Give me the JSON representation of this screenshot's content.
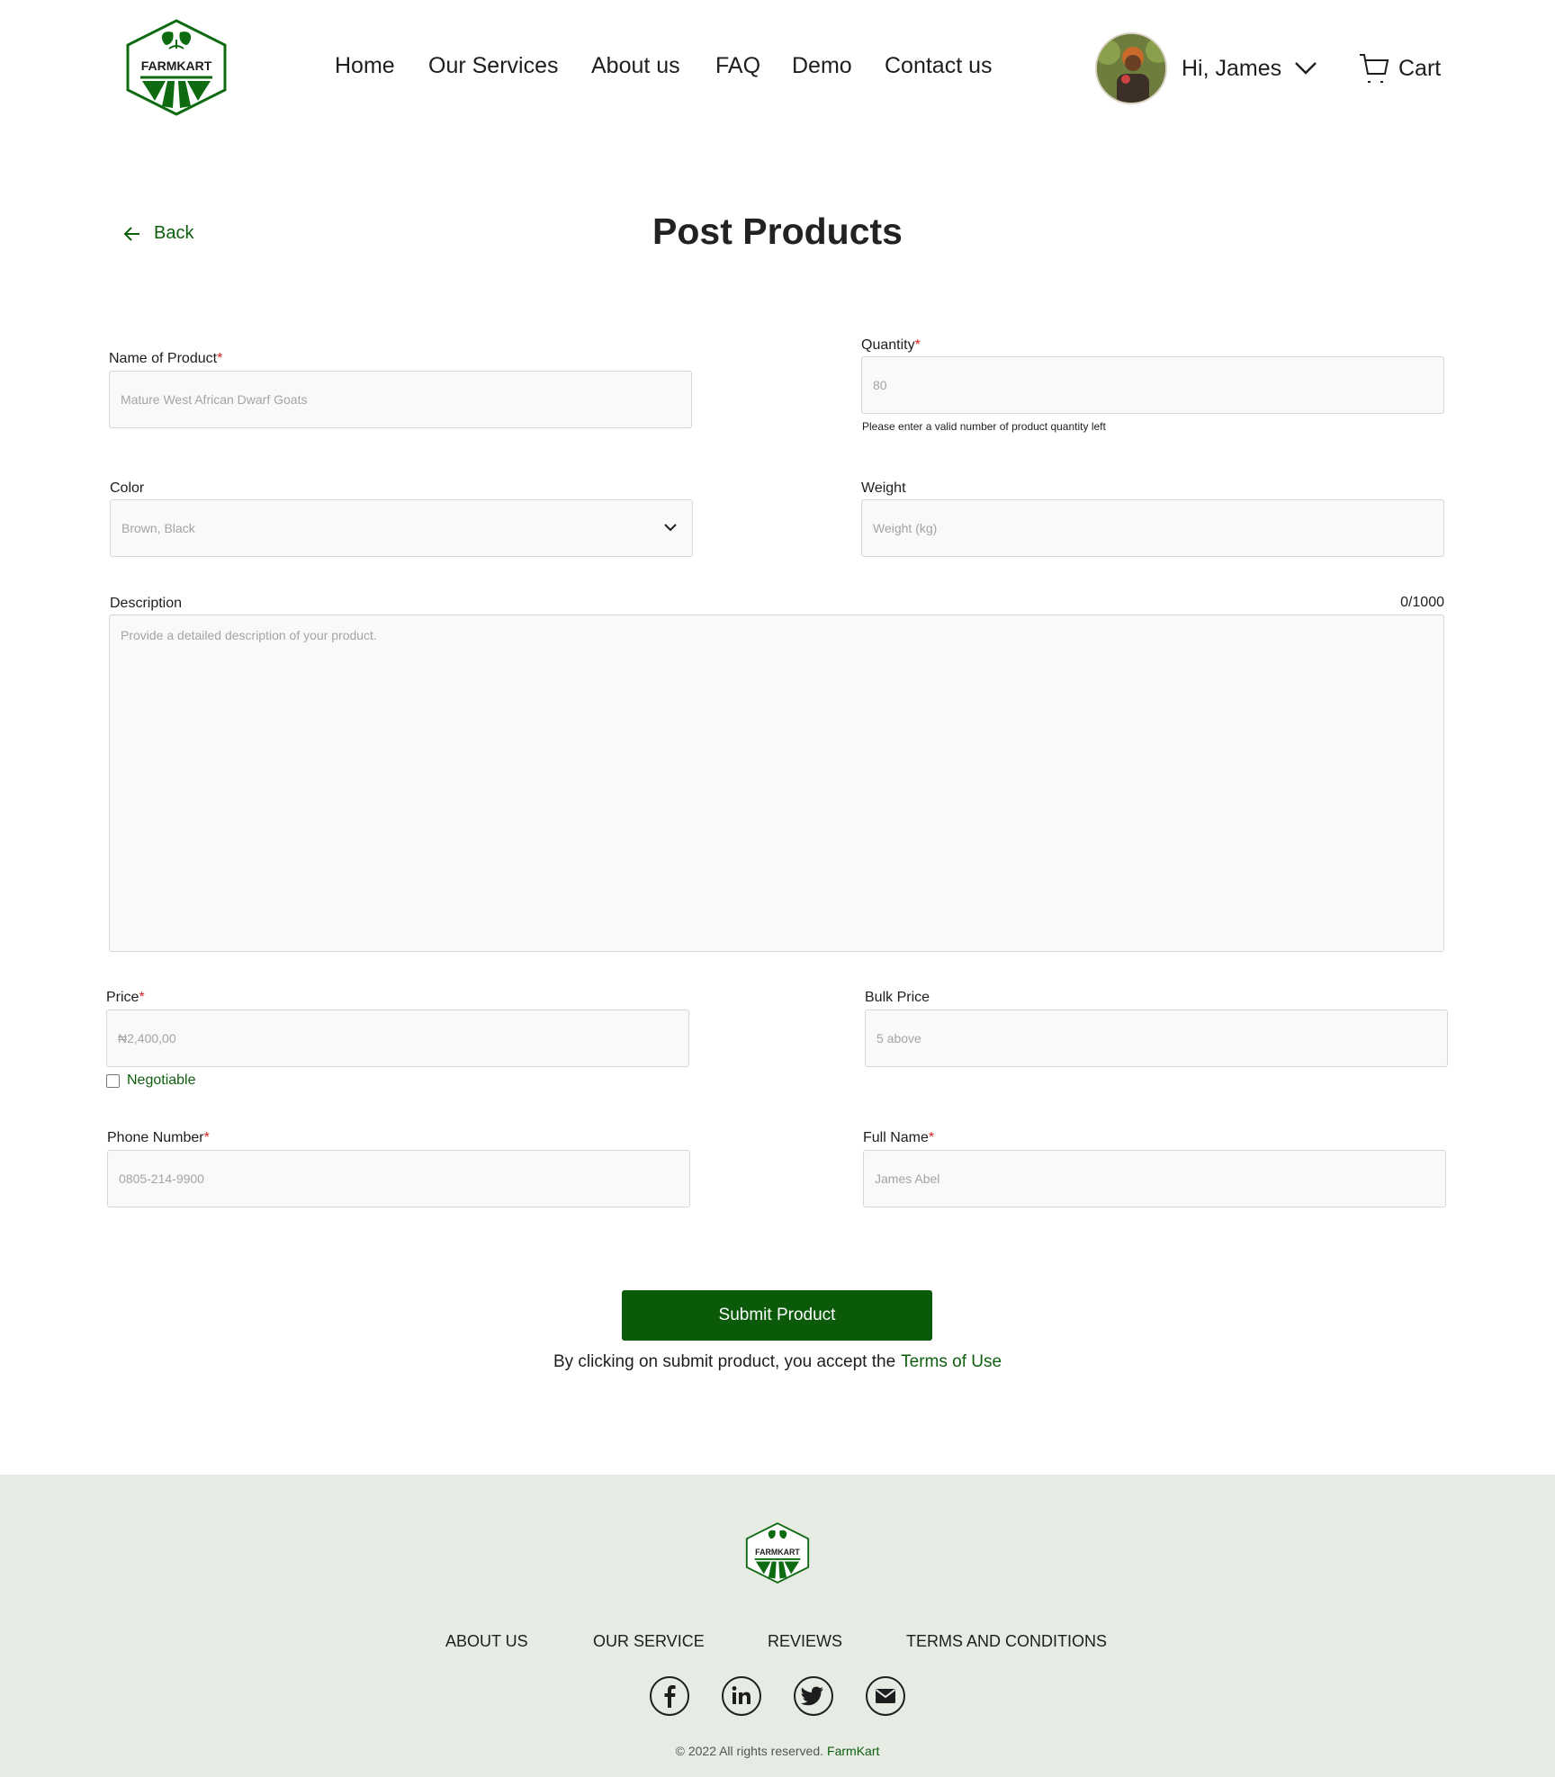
{
  "brand": {
    "logo_text": "FARMKART",
    "accent_color": "#0a5a0a",
    "link_color": "#0e5e0e"
  },
  "nav": {
    "items": [
      {
        "label": "Home"
      },
      {
        "label": "Our Services"
      },
      {
        "label": "About us"
      },
      {
        "label": "FAQ"
      },
      {
        "label": "Demo"
      },
      {
        "label": "Contact us"
      }
    ]
  },
  "user": {
    "greeting": "Hi, James",
    "avatar_icon": "user-avatar",
    "dropdown_icon": "chevron-down-icon"
  },
  "cart": {
    "label": "Cart",
    "icon": "cart-icon"
  },
  "page": {
    "back_label": "Back",
    "title": "Post Products"
  },
  "form": {
    "product_name": {
      "label": "Name of Product",
      "required_mark": "*",
      "placeholder": "Mature West African Dwarf Goats"
    },
    "quantity": {
      "label": "Quantity",
      "required_mark": "*",
      "placeholder": "80",
      "helper": "Please enter a  valid number of product quantity left"
    },
    "color": {
      "label": "Color",
      "selected": "Brown, Black"
    },
    "weight": {
      "label": "Weight",
      "placeholder": "Weight (kg)"
    },
    "description": {
      "label": "Description",
      "counter": "0/1000",
      "placeholder": "Provide a detailed description of your product."
    },
    "price": {
      "label": "Price",
      "required_mark": "*",
      "placeholder": "₦2,400,00"
    },
    "negotiable": {
      "label": "Negotiable",
      "checked": false
    },
    "bulk_price": {
      "label": "Bulk Price",
      "placeholder": "5 above"
    },
    "phone": {
      "label": "Phone Number",
      "required_mark": "*",
      "placeholder": "0805-214-9900"
    },
    "full_name": {
      "label": "Full Name",
      "required_mark": "*",
      "placeholder": "James Abel"
    },
    "submit_label": "Submit Product",
    "terms_text": "By clicking on submit product, you accept the",
    "terms_link": "Terms of Use"
  },
  "footer": {
    "logo_text": "FARMKART",
    "links": [
      {
        "label": "ABOUT US"
      },
      {
        "label": "OUR SERVICE"
      },
      {
        "label": "REVIEWS"
      },
      {
        "label": "TERMS AND CONDITIONS"
      }
    ],
    "socials": [
      "facebook-icon",
      "linkedin-icon",
      "twitter-icon",
      "email-icon"
    ],
    "copyright": "© 2022 All rights reserved.",
    "copyright_brand": "FarmKart",
    "background": "#e6ece4"
  }
}
